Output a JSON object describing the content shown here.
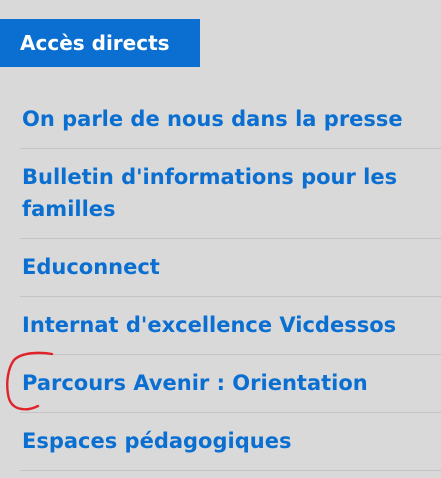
{
  "header": {
    "title": "Accès directs"
  },
  "links": [
    {
      "label": "On parle de nous dans la presse"
    },
    {
      "label": "Bulletin d'informations pour les familles"
    },
    {
      "label": "Educonnect"
    },
    {
      "label": "Internat d'excellence Vicdessos"
    },
    {
      "label": "Parcours Avenir : Orientation"
    },
    {
      "label": "Espaces pédagogiques"
    }
  ],
  "colors": {
    "accent": "#0a6fd1",
    "background": "#d9d9d9",
    "divider": "#c3c3c3",
    "annotation": "#e0232b"
  }
}
